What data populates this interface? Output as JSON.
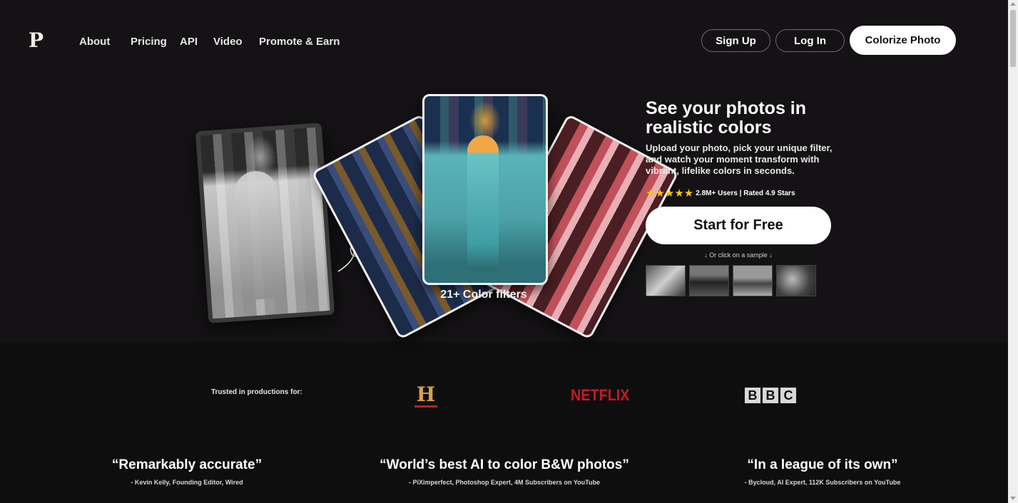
{
  "header": {
    "logo": "P",
    "nav": [
      "About",
      "Pricing",
      "API",
      "Video",
      "Promote & Earn"
    ],
    "sign_up": "Sign Up",
    "log_in": "Log In",
    "colorize": "Colorize Photo"
  },
  "hero": {
    "title": "See your photos in realistic colors",
    "subtitle": "Upload your photo, pick your unique filter, and watch your moment transform with vibrant, lifelike colors in seconds.",
    "stars": "★★★★★",
    "rating_text": "2.8M+ Users | Rated 4.9 Stars",
    "cta": "Start for Free",
    "sample_label": "↓ Or click on a sample ↓",
    "filters_label": "21+ Color filters"
  },
  "trusted": {
    "label": "Trusted in productions for:",
    "history_letter": "H",
    "netflix": "NETFLIX",
    "bbc": [
      "B",
      "B",
      "C"
    ]
  },
  "quotes": [
    {
      "quote": "“Remarkably accurate”",
      "source": "- Kevin Kelly, Founding Editor, Wired"
    },
    {
      "quote": "“World’s best AI to color B&W photos”",
      "source": "- PiXimperfect, Photoshop Expert, 4M Subscribers on YouTube"
    },
    {
      "quote": "“In a league of its own”",
      "source": "- Bycloud, AI Expert, 112K Subscribers on YouTube"
    }
  ],
  "colors": {
    "background": "#141214",
    "star": "#f5c518",
    "netflix": "#c61a22",
    "history": "#d9a24a"
  },
  "icons": [
    "arrow-icon",
    "star-icon",
    "history-logo",
    "netflix-logo",
    "bbc-logo"
  ]
}
